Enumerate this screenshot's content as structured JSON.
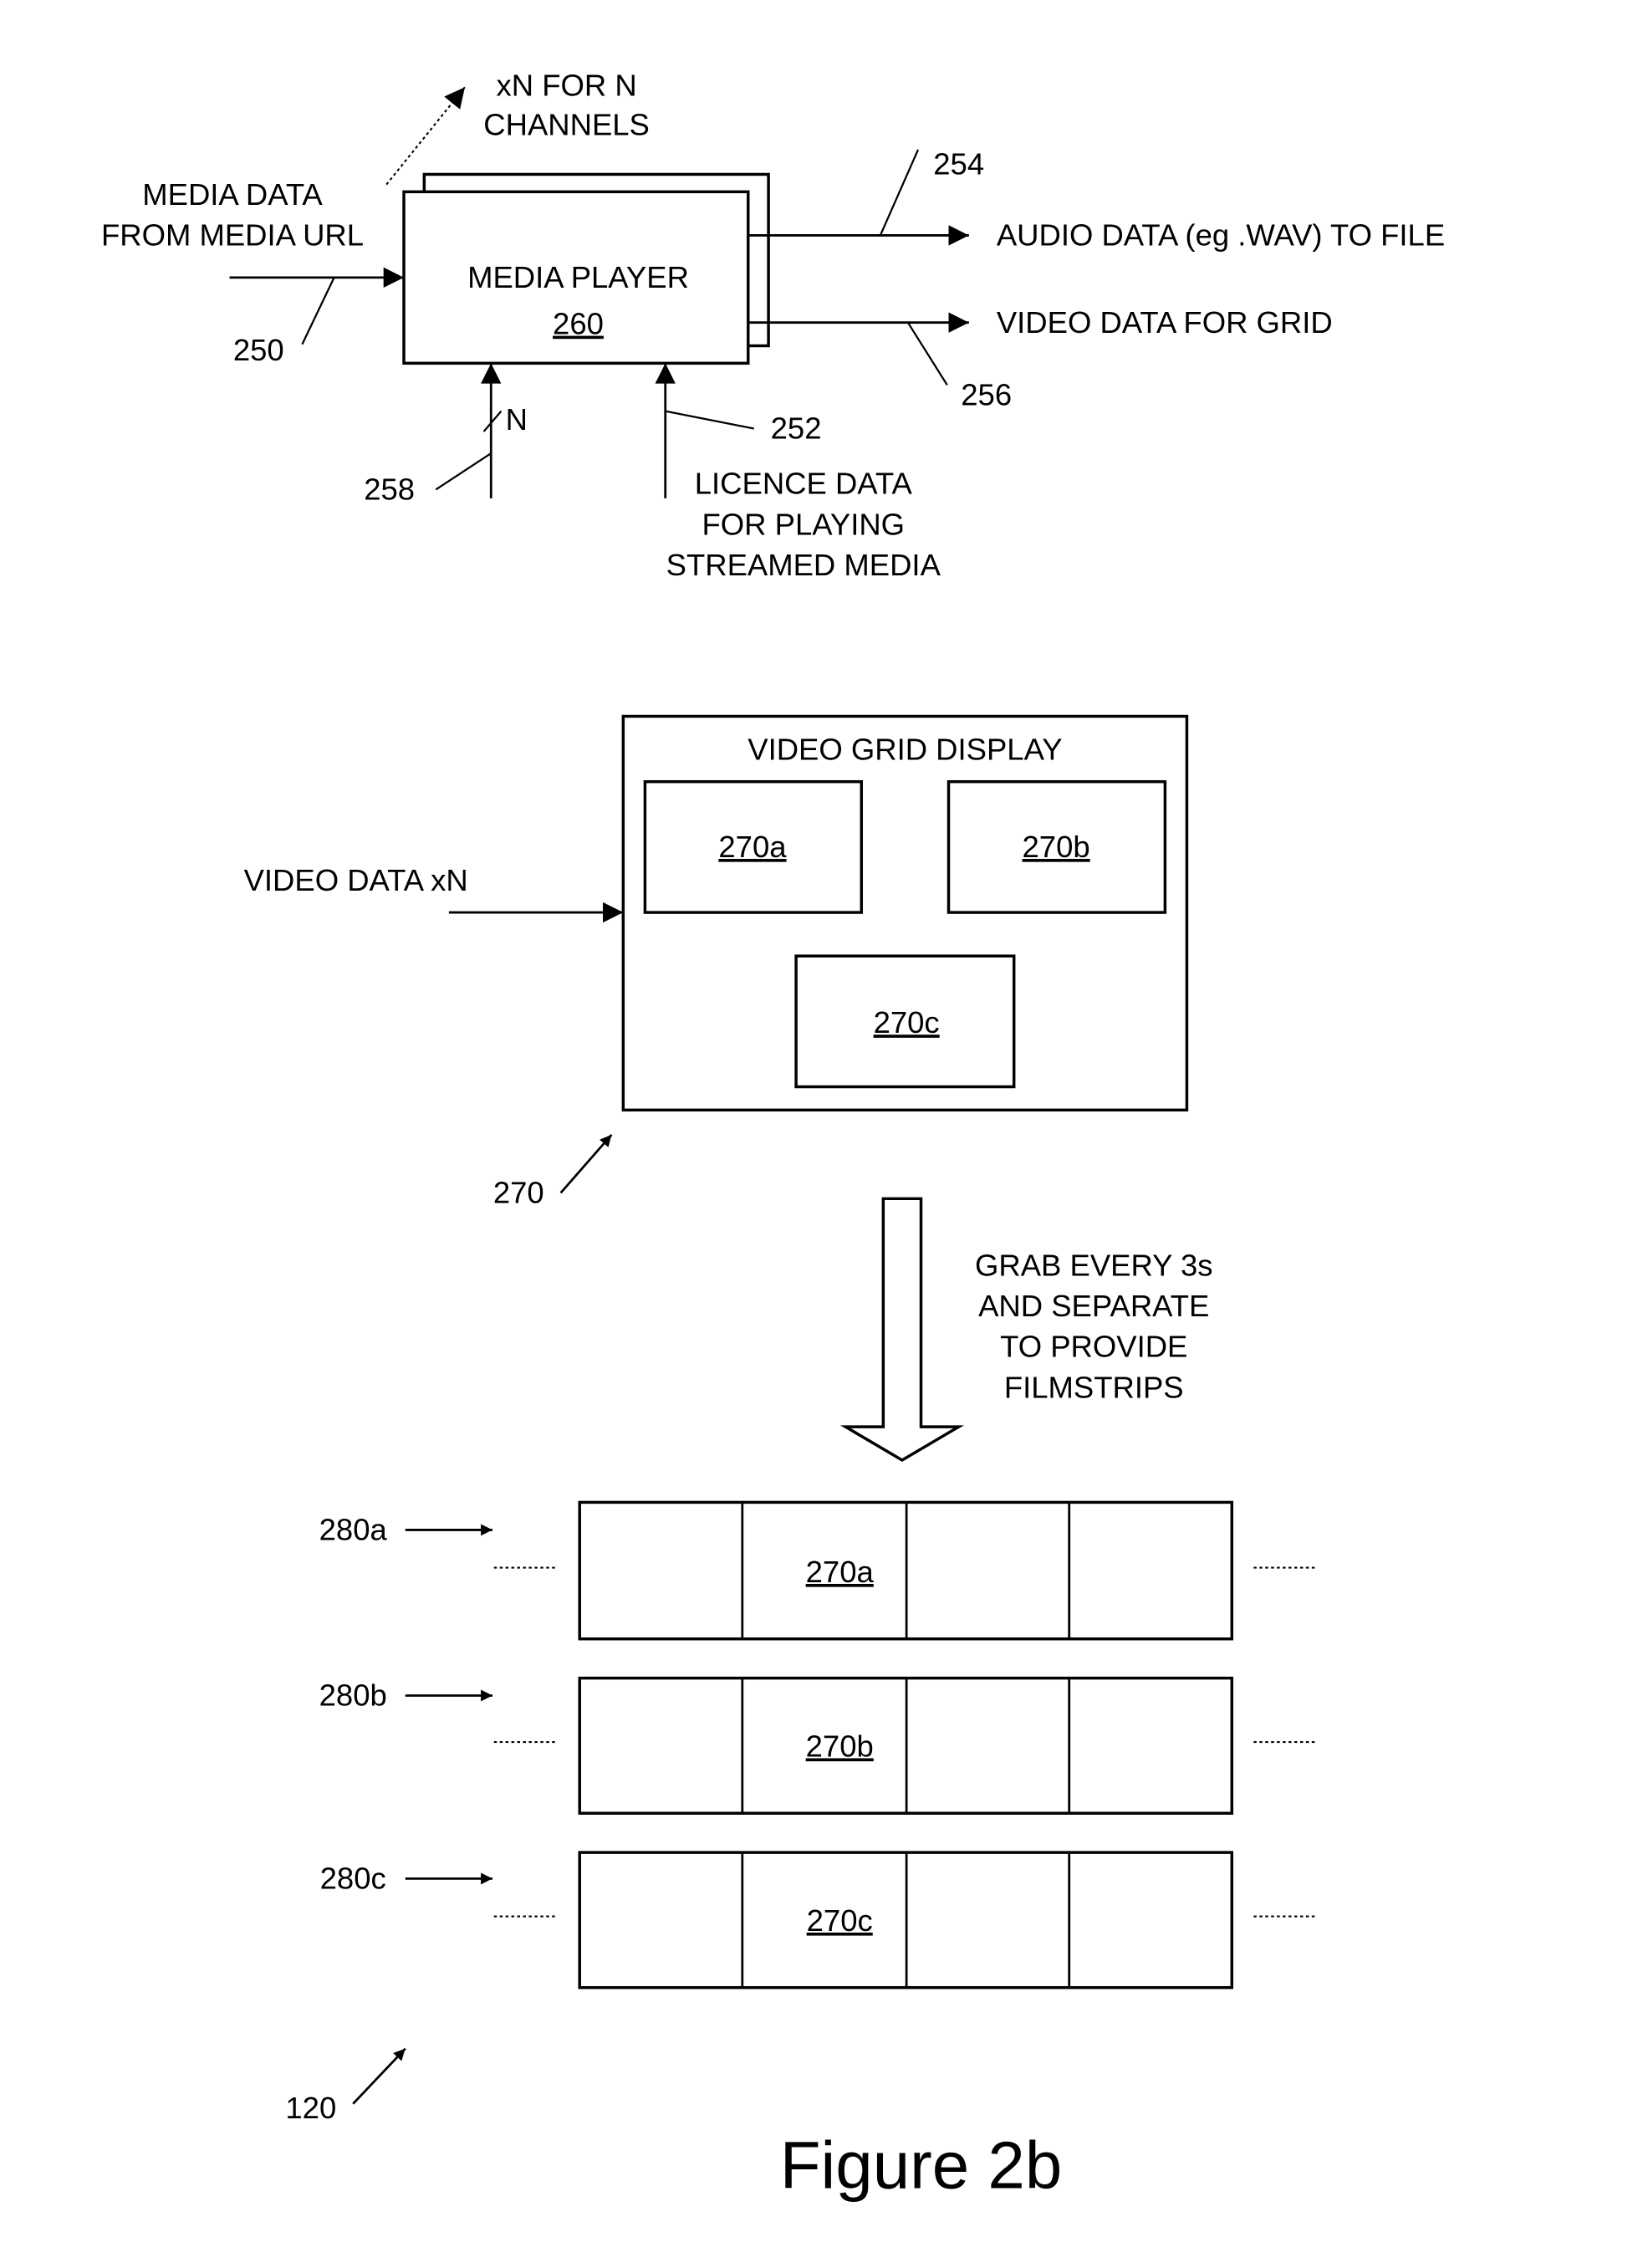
{
  "figure_title": "Figure 2b",
  "media_player": {
    "title": "MEDIA PLAYER",
    "ref": "260",
    "stack_note_line1": "xN FOR N",
    "stack_note_line2": "CHANNELS"
  },
  "inputs": {
    "media_data_line1": "MEDIA DATA",
    "media_data_line2": "FROM MEDIA URL",
    "media_data_ref": "250",
    "channel_ref": "258",
    "channel_count_label": "N",
    "licence_line1": "LICENCE DATA",
    "licence_line2": "FOR PLAYING",
    "licence_line3": "STREAMED MEDIA",
    "licence_ref": "252"
  },
  "outputs": {
    "audio_label": "AUDIO DATA (eg .WAV) TO FILE",
    "audio_ref": "254",
    "video_label": "VIDEO DATA FOR GRID",
    "video_ref": "256"
  },
  "video_grid": {
    "title": "VIDEO GRID DISPLAY",
    "ref": "270",
    "input_label": "VIDEO DATA xN",
    "tiles": [
      "270a",
      "270b",
      "270c"
    ]
  },
  "grab_step": {
    "line1": "GRAB EVERY 3s",
    "line2": "AND SEPARATE",
    "line3": "TO PROVIDE",
    "line4": "FILMSTRIPS"
  },
  "filmstrips": [
    {
      "ref": "280a",
      "frame_label": "270a"
    },
    {
      "ref": "280b",
      "frame_label": "270b"
    },
    {
      "ref": "280c",
      "frame_label": "270c"
    }
  ],
  "system_ref": "120"
}
